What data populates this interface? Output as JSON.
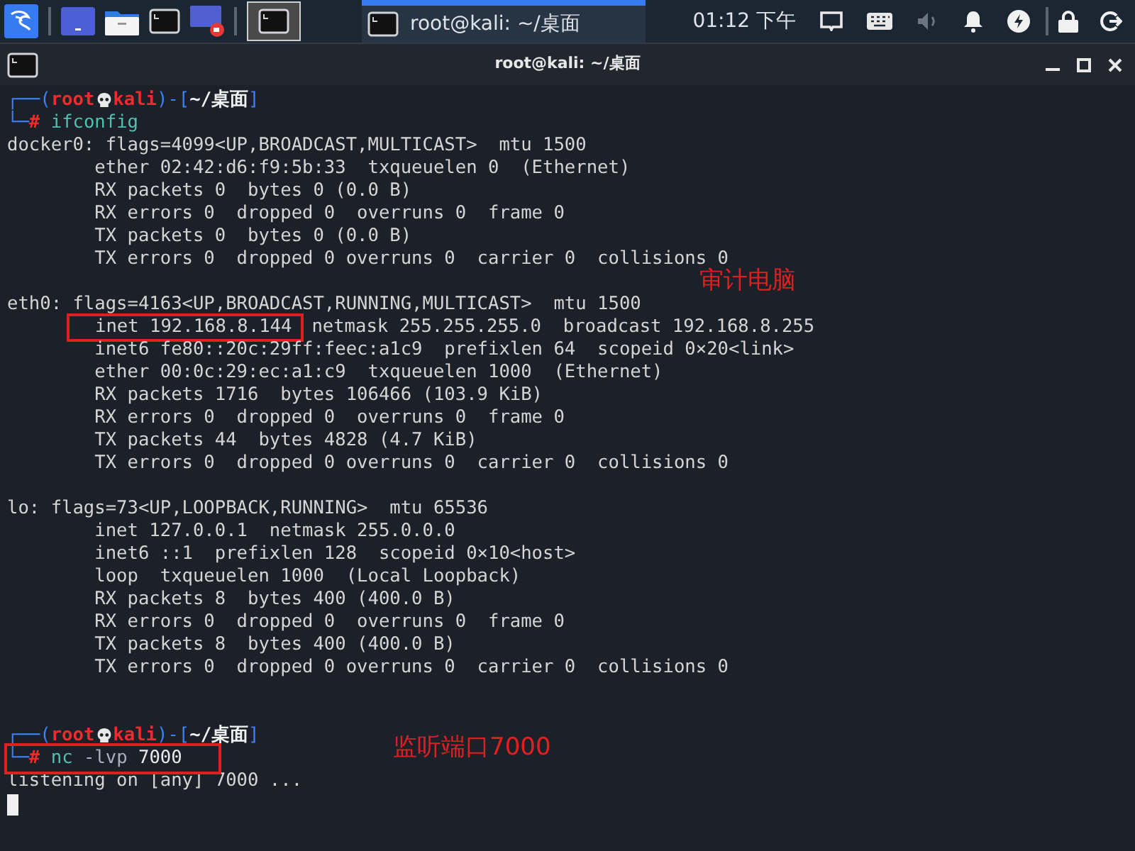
{
  "taskbar": {
    "active_window": {
      "title": "root@kali: ~/桌面",
      "selected": true
    },
    "clock": "01:12 下午"
  },
  "window": {
    "title": "root@kali: ~/桌面"
  },
  "terminal": {
    "lines": [
      {
        "kind": "prompt",
        "open": "┌──(",
        "user": "root",
        "host": "kali",
        "mid": ")-[",
        "path": "~/桌面",
        "close": "]"
      },
      {
        "kind": "command",
        "lead": "└─",
        "symbol": "#",
        "command": "ifconfig",
        "boxed": false
      },
      {
        "kind": "output",
        "text": "docker0: flags=4099<UP,BROADCAST,MULTICAST>  mtu 1500"
      },
      {
        "kind": "output",
        "text": "        ether 02:42:d6:f9:5b:33  txqueuelen 0  (Ethernet)"
      },
      {
        "kind": "output",
        "text": "        RX packets 0  bytes 0 (0.0 B)"
      },
      {
        "kind": "output",
        "text": "        RX errors 0  dropped 0  overruns 0  frame 0"
      },
      {
        "kind": "output",
        "text": "        TX packets 0  bytes 0 (0.0 B)"
      },
      {
        "kind": "output",
        "text": "        TX errors 0  dropped 0 overruns 0  carrier 0  collisions 0"
      },
      {
        "kind": "blank",
        "note": "审计电脑"
      },
      {
        "kind": "output",
        "text": "eth0: flags=4163<UP,BROADCAST,RUNNING,MULTICAST>  mtu 1500"
      },
      {
        "kind": "output",
        "segments": [
          {
            "text": "inet 192.168.8.144",
            "boxed": true
          },
          {
            "text": "netmask 255.255.255.0  broadcast 192.168.8.255",
            "boxed": false
          }
        ]
      },
      {
        "kind": "output",
        "text": "        inet6 fe80::20c:29ff:feec:a1c9  prefixlen 64  scopeid 0×20<link>"
      },
      {
        "kind": "output",
        "text": "        ether 00:0c:29:ec:a1:c9  txqueuelen 1000  (Ethernet)"
      },
      {
        "kind": "output",
        "text": "        RX packets 1716  bytes 106466 (103.9 KiB)"
      },
      {
        "kind": "output",
        "text": "        RX errors 0  dropped 0  overruns 0  frame 0"
      },
      {
        "kind": "output",
        "text": "        TX packets 44  bytes 4828 (4.7 KiB)"
      },
      {
        "kind": "output",
        "text": "        TX errors 0  dropped 0 overruns 0  carrier 0  collisions 0"
      },
      {
        "kind": "blank"
      },
      {
        "kind": "output",
        "text": "lo: flags=73<UP,LOOPBACK,RUNNING>  mtu 65536"
      },
      {
        "kind": "output",
        "text": "        inet 127.0.0.1  netmask 255.0.0.0"
      },
      {
        "kind": "output",
        "text": "        inet6 ::1  prefixlen 128  scopeid 0×10<host>"
      },
      {
        "kind": "output",
        "text": "        loop  txqueuelen 1000  (Local Loopback)"
      },
      {
        "kind": "output",
        "text": "        RX packets 8  bytes 400 (400.0 B)"
      },
      {
        "kind": "output",
        "text": "        RX errors 0  dropped 0  overruns 0  frame 0"
      },
      {
        "kind": "output",
        "text": "        TX packets 8  bytes 400 (400.0 B)"
      },
      {
        "kind": "output",
        "text": "        TX errors 0  dropped 0 overruns 0  carrier 0  collisions 0"
      },
      {
        "kind": "blank"
      },
      {
        "kind": "blank"
      },
      {
        "kind": "prompt",
        "open": "┌──(",
        "user": "root",
        "host": "kali",
        "mid": ")-[",
        "path": "~/桌面",
        "close": "]"
      },
      {
        "kind": "command",
        "lead": "└─",
        "symbol": "#",
        "command": "nc",
        "args": "-lvp",
        "value": "7000",
        "boxed": true,
        "note": "监听端口7000"
      },
      {
        "kind": "output",
        "text": "listening on [any] 7000 ..."
      },
      {
        "kind": "cursor"
      }
    ]
  }
}
